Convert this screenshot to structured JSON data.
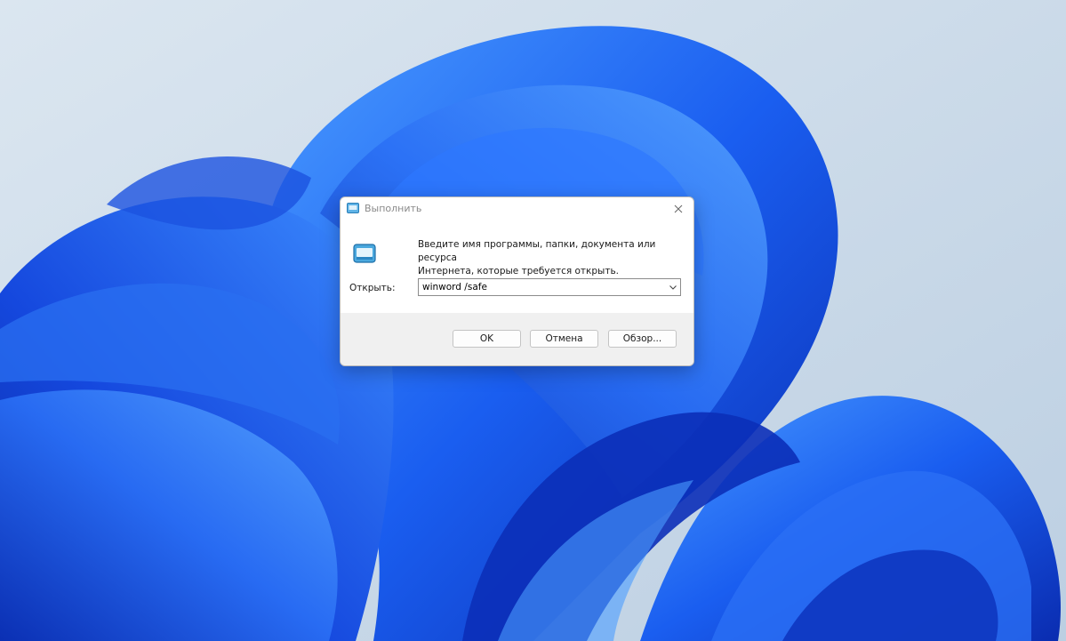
{
  "colors": {
    "wallpaper_bg": "#c9d8e6",
    "bloom_dark": "#0b2fb8",
    "bloom_mid": "#1a57e8",
    "bloom_light": "#3b8cff",
    "dialog_footer": "#f0f0f0"
  },
  "dialog": {
    "title": "Выполнить",
    "title_icon": "run-icon",
    "close_icon": "close-icon",
    "description_line1": "Введите имя программы, папки, документа или ресурса",
    "description_line2": "Интернета, которые требуется открыть.",
    "open_label": "Открыть:",
    "open_value": "winword /safe",
    "buttons": {
      "ok": "OK",
      "cancel": "Отмена",
      "browse": "Обзор..."
    }
  }
}
